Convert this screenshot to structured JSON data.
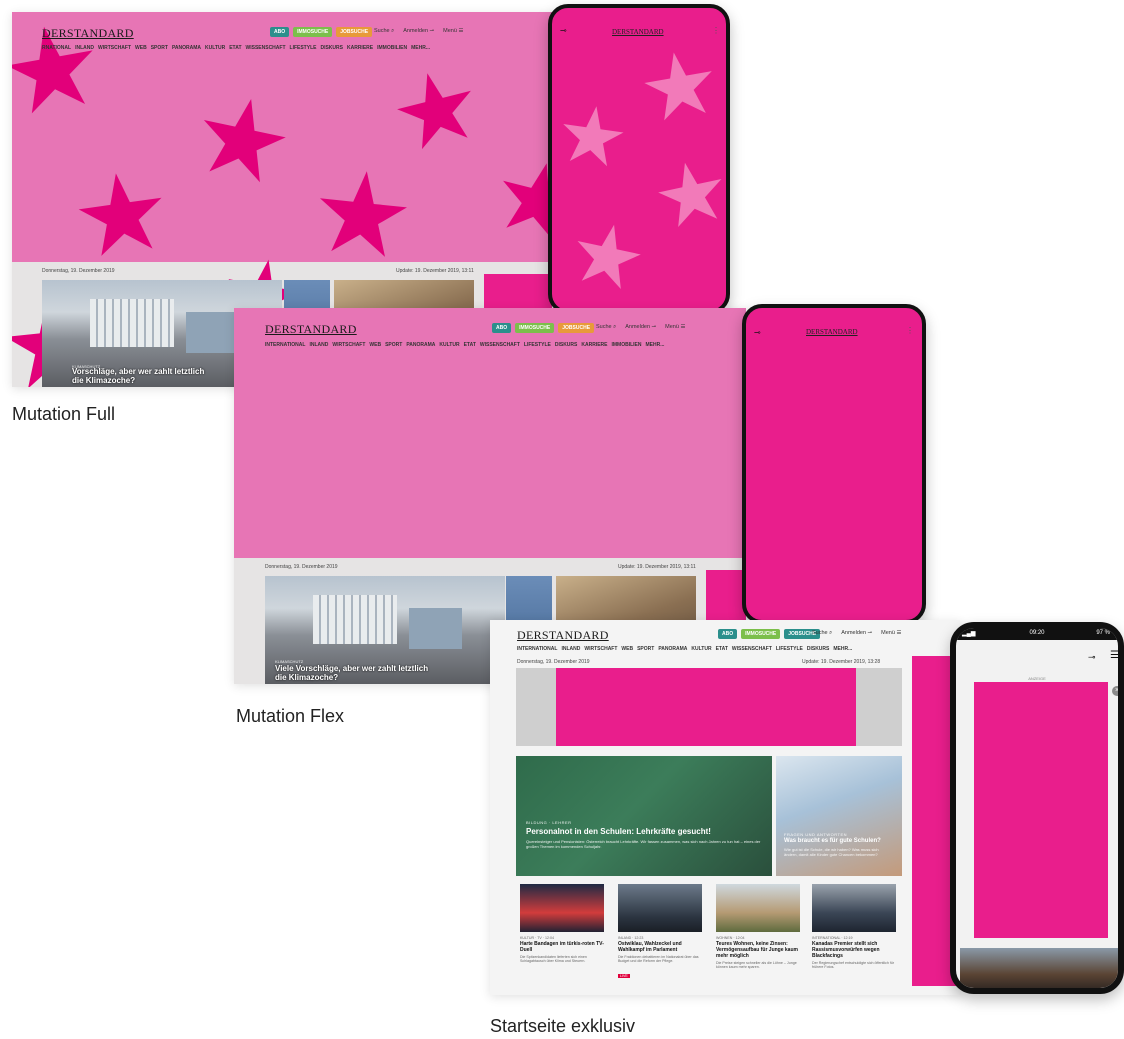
{
  "brand": {
    "logo": "DERSTANDARD",
    "pink": "#e91e8c",
    "pink_light": "#e775b5"
  },
  "header": {
    "buttons": {
      "abo": "ABO",
      "immo": "IMMOSUCHE",
      "job": "JOBSUCHE"
    },
    "search": "Suche",
    "login": "Anmelden",
    "menu": "Menü"
  },
  "nav_items": [
    "INTERNATIONAL",
    "INLAND",
    "WIRTSCHAFT",
    "WEB",
    "SPORT",
    "PANORAMA",
    "KULTUR",
    "ETAT",
    "WISSENSCHAFT",
    "LIFESTYLE",
    "DISKURS",
    "KARRIERE",
    "IMMOBILIEN",
    "MEHR..."
  ],
  "nav_items_full": [
    "RNATIONAL",
    "INLAND",
    "WIRTSCHAFT",
    "WEB",
    "SPORT",
    "PANORAMA",
    "KULTUR",
    "ETAT",
    "WISSENSCHAFT",
    "LIFESTYLE",
    "DISKURS",
    "KARRIERE",
    "IMMOBILIEN",
    "MEHR..."
  ],
  "nav_items_start": [
    "INTERNATIONAL",
    "INLAND",
    "WIRTSCHAFT",
    "WEB",
    "SPORT",
    "PANORAMA",
    "KULTUR",
    "ETAT",
    "WISSENSCHAFT",
    "LIFESTYLE",
    "DISKURS",
    "MEHR..."
  ],
  "dates": {
    "date": "Donnerstag, 19. Dezember 2019",
    "update": "Update: 19. Dezember 2019, 13:11",
    "update_flex": "Update: 19. Dezember 2019, 13:11",
    "update_start": "Update: 19. Dezember 2019, 13:28"
  },
  "lead_story": {
    "kicker": "KLIMASCHUTZ",
    "headline_flex": "Viele Vorschläge, aber wer zahlt letztlich",
    "headline_flex_2": "die Klimazoche?",
    "headline_full": "Vorschläge, aber wer zahlt letztlich",
    "headline_full_2": "die Klimazoche?"
  },
  "captions": {
    "full": "Mutation Full",
    "flex": "Mutation Flex",
    "start": "Startseite exklusiv"
  },
  "tablet": {
    "time": "09:20",
    "battery": "97 %",
    "ad_label": "ANZEIGE"
  },
  "startseite": {
    "main_teaser": {
      "kicker": "BILDUNG · LEHRER",
      "headline": "Personalnot in den Schulen: Lehrkräfte gesucht!",
      "text": "Quereinsteiger und Pensionisten: Österreich braucht Lehrkräfte. Wir fassen zusammen, was sich nach Jahren zu tun hat – eines der großen Themen im kommenden Schuljahr."
    },
    "side_teaser": {
      "kicker": "FRAGEN UND ANTWORTEN",
      "headline": "Was braucht es für gute Schulen?",
      "text": "Wie gut ist die Schule, die wir haben? Was muss sich ändern, damit alle Kinder gute Chancen bekommen?"
    },
    "small_teasers": [
      {
        "kicker": "KULTUR · TV · 12:04",
        "headline": "Harte Bandagen im türkis-roten TV-Duell",
        "text": "Die Spitzenkandidaten lieferten sich einen Schlagabtausch über Klima und Steuern.",
        "tag": ""
      },
      {
        "kicker": "INLAND · 12:23",
        "headline": "Ostwiklau, Wahlzeckel und Wahlkampf im Parlament",
        "text": "Die Fraktionen debattieren im Nationalrat über das Budget und die Reform der Pflege.",
        "tag": "LIVE"
      },
      {
        "kicker": "WOHNEN · 12:04",
        "headline": "Teures Wohnen, keine Zinsen: Vermögensaufbau für Junge kaum mehr möglich",
        "text": "Die Preise steigen schneller als die Löhne – Junge können kaum mehr sparen.",
        "tag": ""
      },
      {
        "kicker": "INTERNATIONAL · 12:19",
        "headline": "Kanadas Premier stellt sich Rassismusvorwürfen wegen Blackfacings",
        "text": "Der Regierungschef entschuldigte sich öffentlich für frühere Fotos.",
        "tag": ""
      }
    ]
  }
}
